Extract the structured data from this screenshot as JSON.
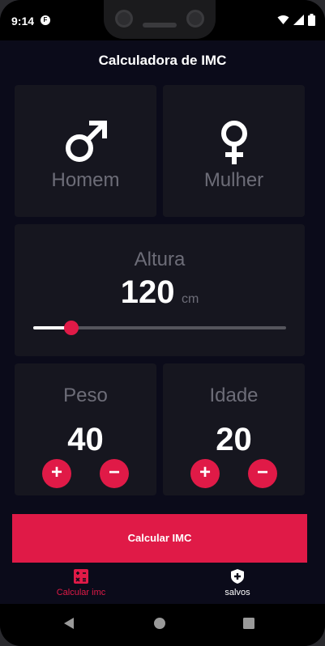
{
  "status_bar": {
    "time": "9:14",
    "app_icon_letter": "F"
  },
  "app_bar": {
    "title": "Calculadora de IMC"
  },
  "gender": {
    "male": {
      "label": "Homem",
      "icon": "male-symbol-icon"
    },
    "female": {
      "label": "Mulher",
      "icon": "female-symbol-icon"
    }
  },
  "height": {
    "title": "Altura",
    "value": "120",
    "unit": "cm",
    "slider_fraction": 0.15
  },
  "weight": {
    "title": "Peso",
    "value": "40",
    "plus": "+",
    "minus": "−"
  },
  "age": {
    "title": "Idade",
    "value": "20",
    "plus": "+",
    "minus": "−"
  },
  "calculate_button": {
    "label": "Calcular IMC"
  },
  "bottom_nav": [
    {
      "label": "Calcular imc",
      "icon": "calculator-icon",
      "active": true
    },
    {
      "label": "salvos",
      "icon": "shield-plus-icon",
      "active": false
    }
  ],
  "colors": {
    "accent": "#e01a47",
    "background": "#0b0b1a",
    "card": "#16161f",
    "muted_text": "#6d6d78"
  }
}
